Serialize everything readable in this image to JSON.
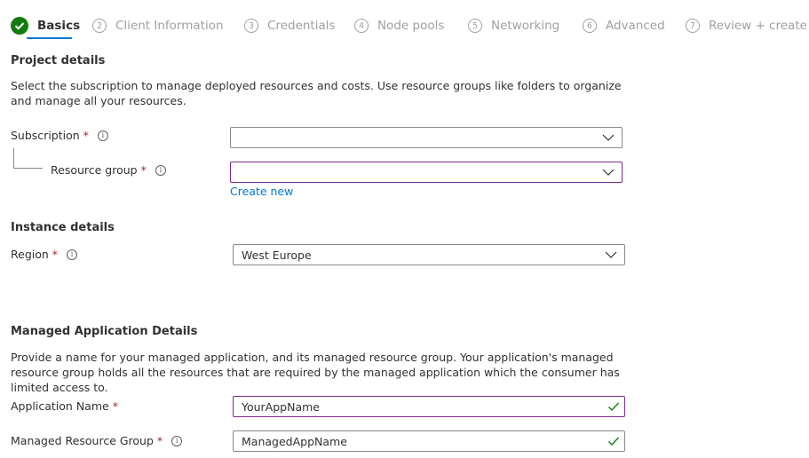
{
  "tabs": [
    {
      "number": "",
      "label": "Basics",
      "state": "complete"
    },
    {
      "number": "2",
      "label": "Client Information"
    },
    {
      "number": "3",
      "label": "Credentials"
    },
    {
      "number": "4",
      "label": "Node pools"
    },
    {
      "number": "5",
      "label": "Networking"
    },
    {
      "number": "6",
      "label": "Advanced"
    },
    {
      "number": "7",
      "label": "Review + create"
    }
  ],
  "project": {
    "title": "Project details",
    "description": "Select the subscription to manage deployed resources and costs. Use resource groups like folders to organize and manage all your resources.",
    "subscription_label": "Subscription",
    "subscription_value": "",
    "resource_group_label": "Resource group",
    "resource_group_value": "",
    "create_new": "Create new"
  },
  "instance": {
    "title": "Instance details",
    "region_label": "Region",
    "region_value": "West Europe"
  },
  "managed_app": {
    "title": "Managed Application Details",
    "description": "Provide a name for your managed application, and its managed resource group. Your application's managed resource group holds all the resources that are required by the managed application which the consumer has limited access to.",
    "app_name_label": "Application Name",
    "app_name_value": "YourAppName",
    "mrg_label": "Managed Resource Group",
    "mrg_value": "ManagedAppName"
  },
  "required_marker": "*",
  "info_glyph": "i",
  "colors": {
    "accent": "#0078d4",
    "success": "#107c10",
    "required": "#a4262c",
    "focus_border": "#7a2b8c"
  }
}
